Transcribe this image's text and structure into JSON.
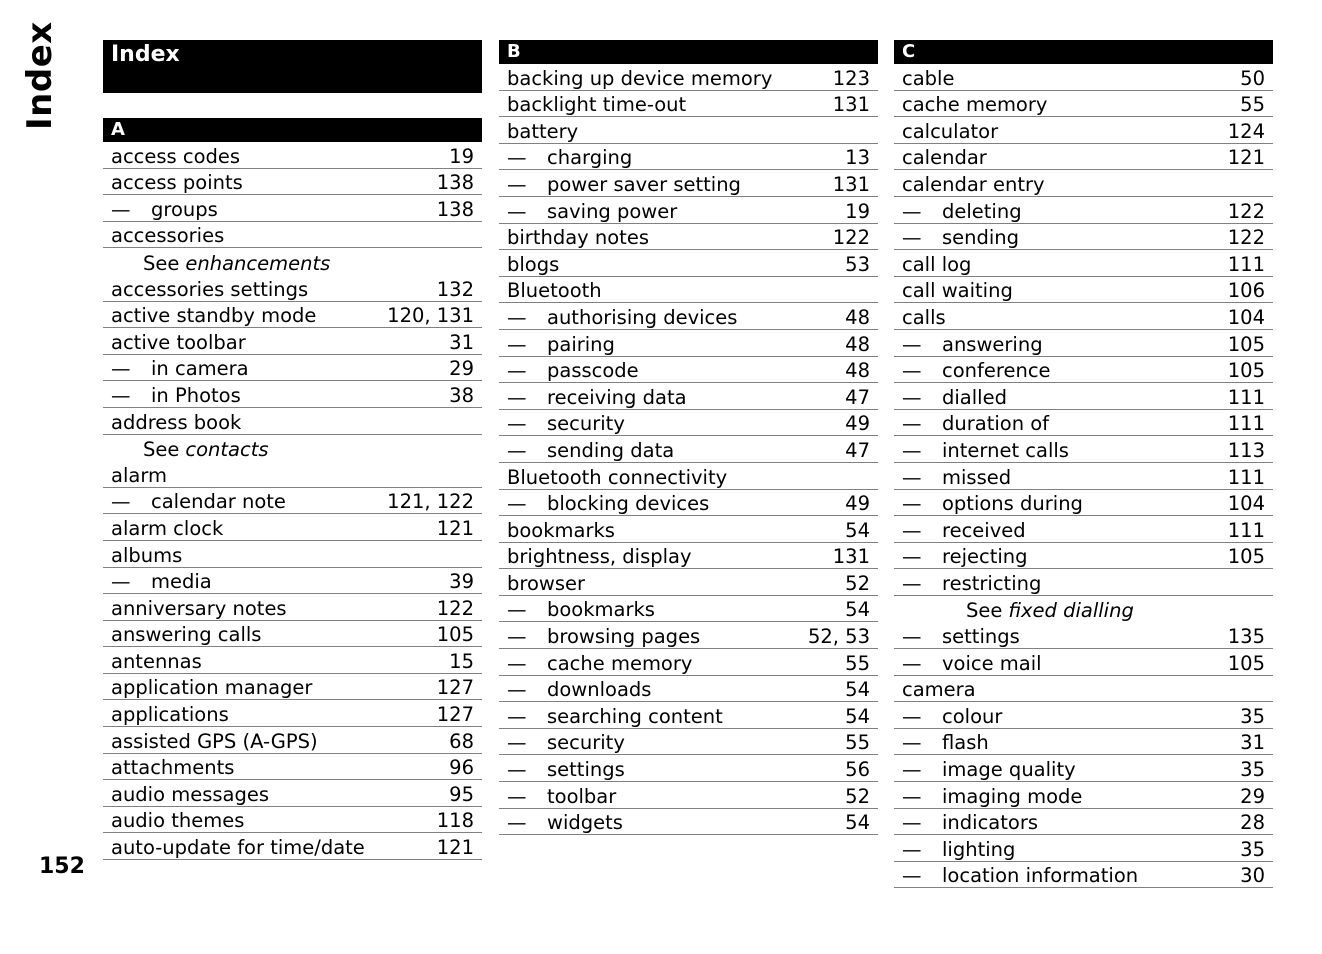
{
  "side_title": "Index",
  "page_number": "152",
  "columns": [
    {
      "header": "Index",
      "letter": "A",
      "entries": [
        {
          "term": "access codes",
          "pages": "19"
        },
        {
          "term": "access points",
          "pages": "138"
        },
        {
          "term": "groups",
          "pages": "138",
          "sub": true
        },
        {
          "term": "accessories",
          "pages": ""
        },
        {
          "see": "enhancements"
        },
        {
          "term": "accessories settings",
          "pages": "132"
        },
        {
          "term": "active standby mode",
          "pages": "120, 131"
        },
        {
          "term": "active toolbar",
          "pages": "31"
        },
        {
          "term": "in camera",
          "pages": "29",
          "sub": true
        },
        {
          "term": "in Photos",
          "pages": "38",
          "sub": true
        },
        {
          "term": "address book",
          "pages": ""
        },
        {
          "see": "contacts"
        },
        {
          "term": "alarm",
          "pages": ""
        },
        {
          "term": "calendar note",
          "pages": "121, 122",
          "sub": true
        },
        {
          "term": "alarm clock",
          "pages": "121"
        },
        {
          "term": "albums",
          "pages": ""
        },
        {
          "term": "media",
          "pages": "39",
          "sub": true
        },
        {
          "term": "anniversary notes",
          "pages": "122"
        },
        {
          "term": "answering calls",
          "pages": "105"
        },
        {
          "term": "antennas",
          "pages": "15"
        },
        {
          "term": "application manager",
          "pages": "127"
        },
        {
          "term": "applications",
          "pages": "127"
        },
        {
          "term": "assisted GPS (A-GPS)",
          "pages": "68"
        },
        {
          "term": "attachments",
          "pages": "96"
        },
        {
          "term": "audio messages",
          "pages": "95"
        },
        {
          "term": "audio themes",
          "pages": "118"
        },
        {
          "term": "auto-update for time/date",
          "pages": "121"
        }
      ]
    },
    {
      "letter": "B",
      "entries": [
        {
          "term": "backing up device memory",
          "pages": "123"
        },
        {
          "term": "backlight time-out",
          "pages": "131"
        },
        {
          "term": "battery",
          "pages": ""
        },
        {
          "term": "charging",
          "pages": "13",
          "sub": true
        },
        {
          "term": "power saver setting",
          "pages": "131",
          "sub": true
        },
        {
          "term": "saving power",
          "pages": "19",
          "sub": true
        },
        {
          "term": "birthday notes",
          "pages": "122"
        },
        {
          "term": "blogs",
          "pages": "53"
        },
        {
          "term": "Bluetooth",
          "pages": ""
        },
        {
          "term": "authorising devices",
          "pages": "48",
          "sub": true
        },
        {
          "term": "pairing",
          "pages": "48",
          "sub": true
        },
        {
          "term": "passcode",
          "pages": "48",
          "sub": true
        },
        {
          "term": "receiving data",
          "pages": "47",
          "sub": true
        },
        {
          "term": "security",
          "pages": "49",
          "sub": true
        },
        {
          "term": "sending data",
          "pages": "47",
          "sub": true
        },
        {
          "term": "Bluetooth connectivity",
          "pages": ""
        },
        {
          "term": "blocking devices",
          "pages": "49",
          "sub": true
        },
        {
          "term": "bookmarks",
          "pages": "54"
        },
        {
          "term": "brightness, display",
          "pages": "131"
        },
        {
          "term": "browser",
          "pages": "52"
        },
        {
          "term": "bookmarks",
          "pages": "54",
          "sub": true
        },
        {
          "term": "browsing pages",
          "pages": "52, 53",
          "sub": true
        },
        {
          "term": "cache memory",
          "pages": "55",
          "sub": true
        },
        {
          "term": "downloads",
          "pages": "54",
          "sub": true
        },
        {
          "term": "searching content",
          "pages": "54",
          "sub": true
        },
        {
          "term": "security",
          "pages": "55",
          "sub": true
        },
        {
          "term": "settings",
          "pages": "56",
          "sub": true
        },
        {
          "term": "toolbar",
          "pages": "52",
          "sub": true
        },
        {
          "term": "widgets",
          "pages": "54",
          "sub": true
        }
      ]
    },
    {
      "letter": "C",
      "entries": [
        {
          "term": "cable",
          "pages": "50"
        },
        {
          "term": "cache memory",
          "pages": "55"
        },
        {
          "term": "calculator",
          "pages": "124"
        },
        {
          "term": "calendar",
          "pages": "121"
        },
        {
          "term": "calendar entry",
          "pages": ""
        },
        {
          "term": "deleting",
          "pages": "122",
          "sub": true
        },
        {
          "term": "sending",
          "pages": "122",
          "sub": true
        },
        {
          "term": "call log",
          "pages": "111"
        },
        {
          "term": "call waiting",
          "pages": "106"
        },
        {
          "term": "calls",
          "pages": "104"
        },
        {
          "term": "answering",
          "pages": "105",
          "sub": true
        },
        {
          "term": "conference",
          "pages": "105",
          "sub": true
        },
        {
          "term": "dialled",
          "pages": "111",
          "sub": true
        },
        {
          "term": "duration of",
          "pages": "111",
          "sub": true
        },
        {
          "term": "internet calls",
          "pages": "113",
          "sub": true
        },
        {
          "term": "missed",
          "pages": "111",
          "sub": true
        },
        {
          "term": "options during",
          "pages": "104",
          "sub": true
        },
        {
          "term": "received",
          "pages": "111",
          "sub": true
        },
        {
          "term": "rejecting",
          "pages": "105",
          "sub": true
        },
        {
          "term": "restricting",
          "pages": "",
          "sub": true
        },
        {
          "see": "fixed dialling",
          "indent": true
        },
        {
          "term": "settings",
          "pages": "135",
          "sub": true
        },
        {
          "term": "voice mail",
          "pages": "105",
          "sub": true
        },
        {
          "term": "camera",
          "pages": ""
        },
        {
          "term": "colour",
          "pages": "35",
          "sub": true
        },
        {
          "term": "flash",
          "pages": "31",
          "sub": true
        },
        {
          "term": "image quality",
          "pages": "35",
          "sub": true
        },
        {
          "term": "imaging mode",
          "pages": "29",
          "sub": true
        },
        {
          "term": "indicators",
          "pages": "28",
          "sub": true
        },
        {
          "term": "lighting",
          "pages": "35",
          "sub": true
        },
        {
          "term": "location information",
          "pages": "30",
          "sub": true
        }
      ]
    }
  ],
  "labels": {
    "see": "See",
    "dash": "—"
  }
}
